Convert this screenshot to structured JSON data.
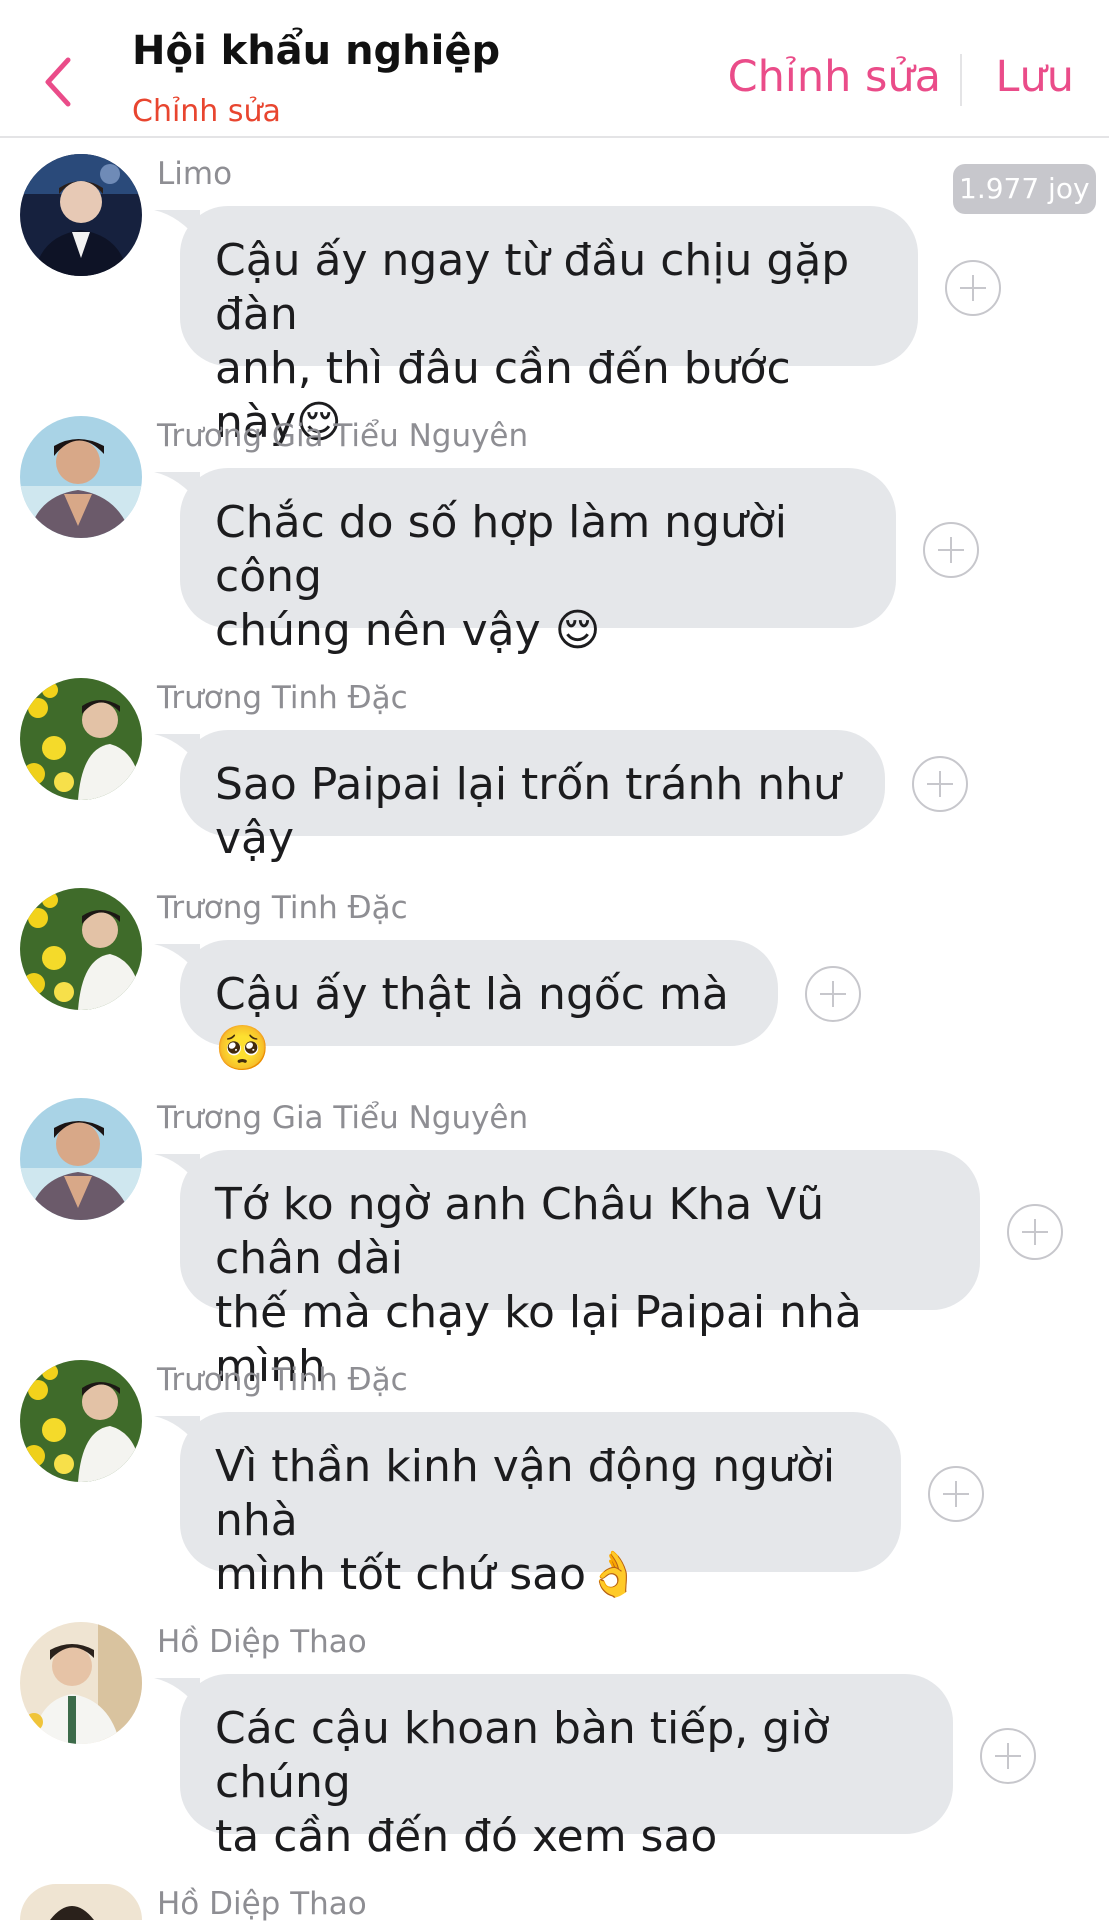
{
  "header": {
    "title": "Hội khẩu nghiệp",
    "subtitle": "Chỉnh sửa",
    "edit_label": "Chỉnh sửa",
    "save_label": "Lưu"
  },
  "badge": "1.977 joy",
  "messages": [
    {
      "sender": "Limo",
      "lines": [
        "Cậu ấy ngay từ đầu chịu gặp đàn",
        "anh, thì đâu cần đến bước này😌"
      ]
    },
    {
      "sender": "Trương Gia Tiểu Nguyên",
      "lines": [
        "Chắc do số hợp làm người công",
        "chúng nên vậy 😌"
      ]
    },
    {
      "sender": "Trương Tinh Đặc",
      "lines": [
        "Sao Paipai lại trốn tránh như vậy"
      ]
    },
    {
      "sender": "Trương Tinh Đặc",
      "lines": [
        "Cậu ấy thật là ngốc mà 🥺"
      ]
    },
    {
      "sender": "Trương Gia Tiểu Nguyên",
      "lines": [
        "Tớ ko ngờ anh Châu Kha Vũ chân dài",
        "thế mà chạy ko lại Paipai nhà mình"
      ]
    },
    {
      "sender": "Trương Tinh Đặc",
      "lines": [
        "Vì thần kinh vận động người nhà",
        "mình tốt chứ sao👌"
      ]
    },
    {
      "sender": "Hồ Diệp Thao",
      "lines": [
        "Các cậu khoan bàn tiếp, giờ chúng",
        "ta cần đến đó xem sao"
      ]
    },
    {
      "sender": "Hồ Diệp Thao",
      "lines": []
    }
  ],
  "colors": {
    "accent": "#ea4c89",
    "subtitle": "#e8452f",
    "bubble": "#e5e7ea",
    "sender": "#8e8e93"
  }
}
